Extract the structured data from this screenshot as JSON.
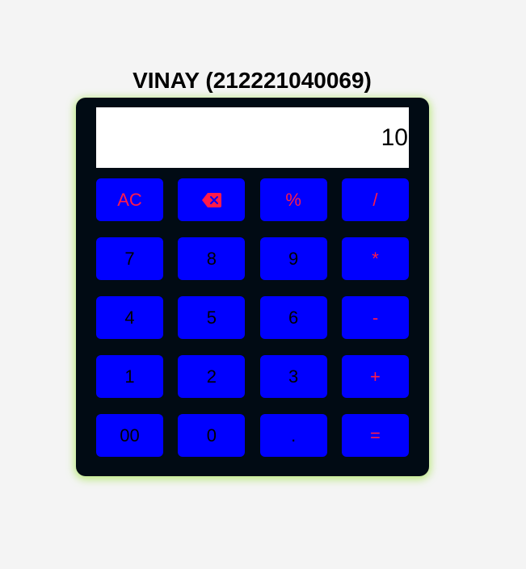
{
  "title": "VINAY (212221040069)",
  "display": {
    "value": "10"
  },
  "colors": {
    "page_bg": "#f4f4f4",
    "calc_bg": "#010b14",
    "key_bg": "#0000ff",
    "operator_text": "#ff1a4a",
    "digit_text": "#000000",
    "glow": "#aae65a"
  },
  "keys": [
    {
      "name": "clear-button",
      "label": "AC",
      "type": "op"
    },
    {
      "name": "backspace-button",
      "label": "",
      "type": "op",
      "icon": "backspace-icon"
    },
    {
      "name": "percent-button",
      "label": "%",
      "type": "op"
    },
    {
      "name": "divide-button",
      "label": "/",
      "type": "op"
    },
    {
      "name": "digit-7-button",
      "label": "7",
      "type": "digit"
    },
    {
      "name": "digit-8-button",
      "label": "8",
      "type": "digit"
    },
    {
      "name": "digit-9-button",
      "label": "9",
      "type": "digit"
    },
    {
      "name": "multiply-button",
      "label": "*",
      "type": "op"
    },
    {
      "name": "digit-4-button",
      "label": "4",
      "type": "digit"
    },
    {
      "name": "digit-5-button",
      "label": "5",
      "type": "digit"
    },
    {
      "name": "digit-6-button",
      "label": "6",
      "type": "digit"
    },
    {
      "name": "subtract-button",
      "label": "-",
      "type": "op"
    },
    {
      "name": "digit-1-button",
      "label": "1",
      "type": "digit"
    },
    {
      "name": "digit-2-button",
      "label": "2",
      "type": "digit"
    },
    {
      "name": "digit-3-button",
      "label": "3",
      "type": "digit"
    },
    {
      "name": "add-button",
      "label": "+",
      "type": "op"
    },
    {
      "name": "double-zero-button",
      "label": "00",
      "type": "digit"
    },
    {
      "name": "digit-0-button",
      "label": "0",
      "type": "digit"
    },
    {
      "name": "decimal-button",
      "label": ".",
      "type": "digit"
    },
    {
      "name": "equals-button",
      "label": "=",
      "type": "op"
    }
  ]
}
